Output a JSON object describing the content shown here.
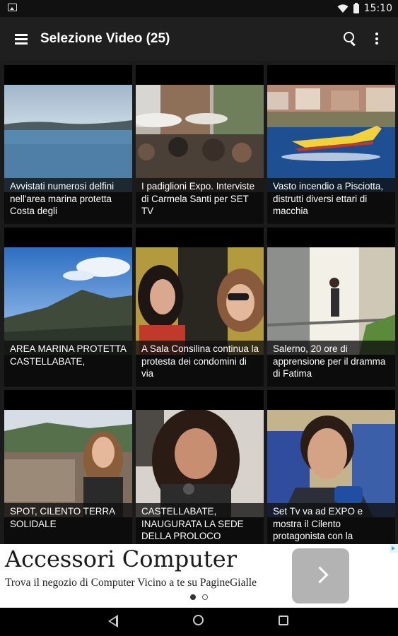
{
  "statusbar": {
    "time": "15:10"
  },
  "toolbar": {
    "title": "Selezione Video (25)"
  },
  "videos": [
    {
      "title": "Avvistati numerosi delfini nell'area marina protetta Costa degli"
    },
    {
      "title": "I padiglioni Expo. Interviste di Carmela Santi per SET TV"
    },
    {
      "title": "Vasto incendio a Pisciotta, distrutti diversi ettari di macchia"
    },
    {
      "title": "AREA MARINA PROTETTA CASTELLABATE,"
    },
    {
      "title": "A Sala Consilina continua la protesta dei condomini di via"
    },
    {
      "title": "Salerno, 20 ore di apprensione per il dramma di Fatima"
    },
    {
      "title": "SPOT, CILENTO TERRA SOLIDALE"
    },
    {
      "title": "CASTELLABATE, INAUGURATA LA SEDE DELLA PROLOCO"
    },
    {
      "title": "Set Tv va ad EXPO e mostra il Cilento protagonista con la"
    }
  ],
  "ad": {
    "headline": "Accessori Computer",
    "subline": "Trova il negozio di Computer Vicino a te su PagineGialle"
  },
  "colors": {
    "background": "#1b1b1b",
    "toolbar": "#1f1f1f",
    "ad_button": "#b3b3b3"
  }
}
